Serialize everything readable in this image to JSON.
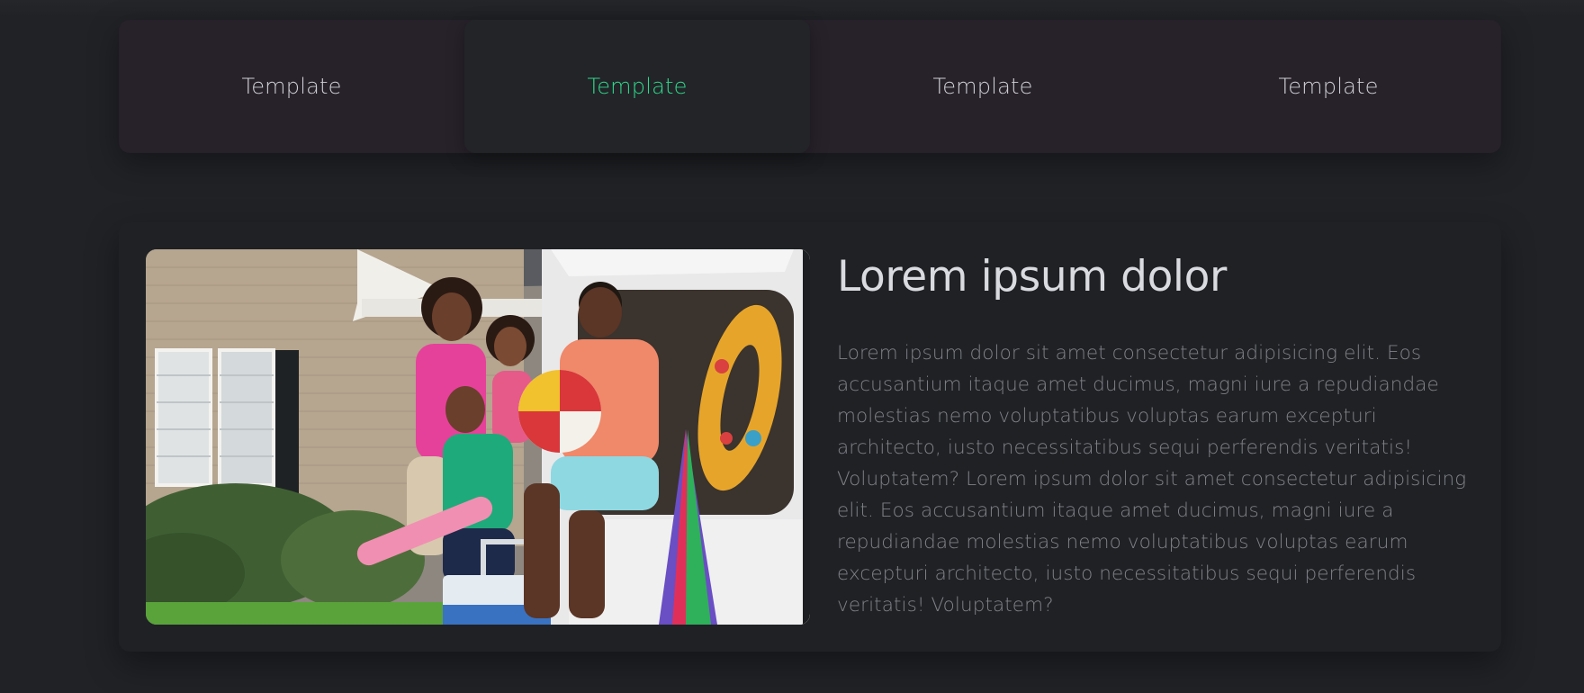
{
  "tabs": [
    {
      "label": "Template",
      "active": false
    },
    {
      "label": "Template",
      "active": true
    },
    {
      "label": "Template",
      "active": false
    },
    {
      "label": "Template",
      "active": false
    }
  ],
  "content": {
    "heading": "Lorem ipsum dolor",
    "body": "Lorem ipsum dolor sit amet consectetur adipisicing elit. Eos accusantium itaque amet ducimus, magni iure a repudiandae molestias nemo voluptatibus voluptas earum excepturi architecto, iusto necessitatibus sequi perferendis veritatis! Voluptatem? Lorem ipsum dolor sit amet consectetur adipisicing elit. Eos accusantium itaque amet ducimus, magni iure a repudiandae molestias nemo voluptatibus voluptas earum excepturi architecto, iusto necessitatibus sequi perferendis veritatis! Voluptatem?"
  },
  "colors": {
    "background": "#202226",
    "tab_strip": "#27212a",
    "active_tab_text": "#2fd98b",
    "tab_text": "#cfd1d6",
    "heading": "#d9dbe0",
    "body_text": "#7f8187"
  }
}
